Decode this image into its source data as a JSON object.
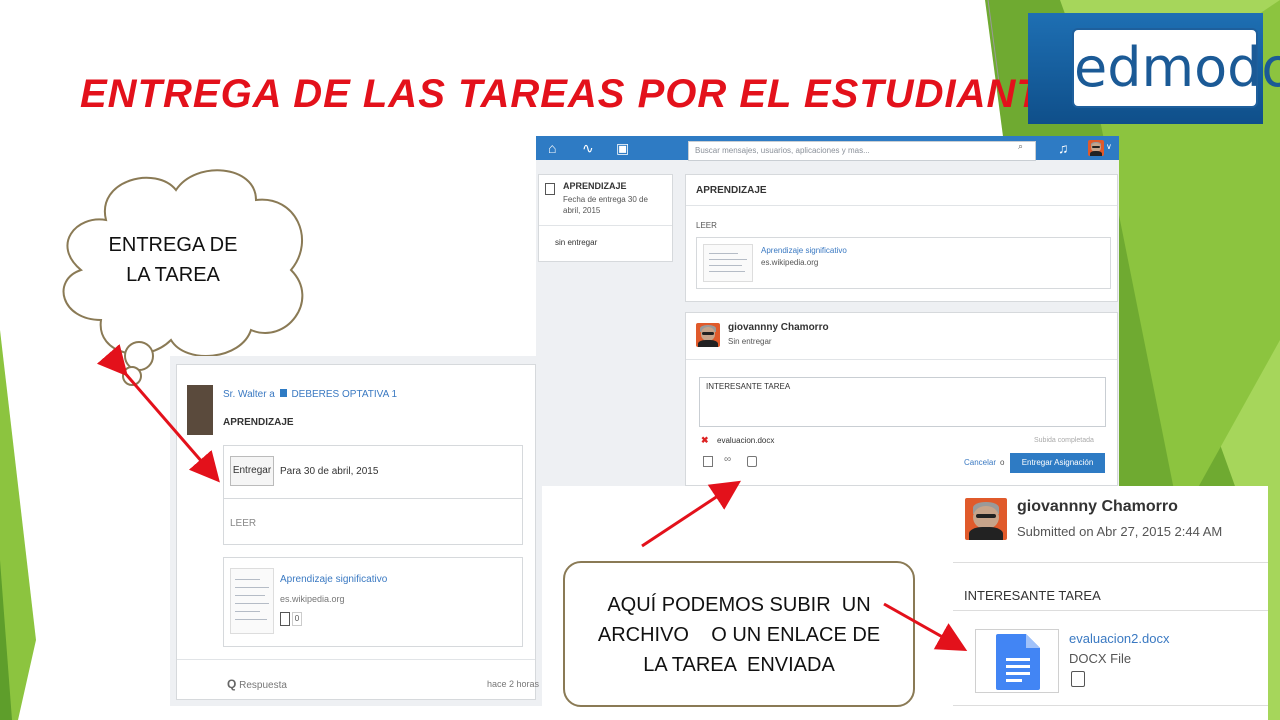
{
  "slide": {
    "title": "ENTREGA DE LAS TAREAS POR EL ESTUDIANTE",
    "logo_text": "edmodo",
    "cloud_line1": "ENTREGA DE",
    "cloud_line2": "LA TAREA",
    "callout_line1": "AQUÍ PODEMOS SUBIR  UN",
    "callout_line2": "ARCHIVO    O UN ENLACE DE",
    "callout_line3": "LA TAREA  ENVIADA"
  },
  "student_view": {
    "post_author": "Sr. Walter a",
    "group_name": "DEBERES OPTATIVA 1",
    "assignment_title": "APRENDIZAJE",
    "submit_button": "Entregar",
    "due_text": "Para 30 de abril, 2015",
    "read_label": "LEER",
    "link_title": "Aprendizaje significativo",
    "link_domain": "es.wikipedia.org",
    "link_count": "0",
    "reply_label": "Respuesta",
    "time_ago": "hace 2 horas"
  },
  "edmodo_app": {
    "search_placeholder": "Buscar mensajes, usuarios, aplicaciones y mas...",
    "sidebar_title": "APRENDIZAJE",
    "sidebar_due_line1": "Fecha de entrega 30 de",
    "sidebar_due_line2": "abril, 2015",
    "sidebar_status": "sin entregar",
    "assignment_heading": "APRENDIZAJE",
    "read_label": "LEER",
    "link_title": "Aprendizaje significativo",
    "link_domain": "es.wikipedia.org",
    "student_name": "giovannny Chamorro",
    "student_status": "Sin entregar",
    "comment_text": "INTERESANTE TAREA",
    "file_name": "evaluacion.docx",
    "upload_status": "Subida completada",
    "cancel_label": "Cancelar",
    "or_label": "o",
    "submit_assignment_button": "Entregar Asignación"
  },
  "teacher_view": {
    "student_name": "giovannny Chamorro",
    "submitted_text": "Submitted on Abr 27, 2015 2:44 AM",
    "comment_text": "INTERESANTE TAREA",
    "file_name": "evaluacion2.docx",
    "file_type": "DOCX File"
  },
  "colors": {
    "title_red": "#e3111b",
    "edmodo_blue": "#2e7bc4",
    "green_light": "#9bd24a",
    "green_dark": "#5e9e2b",
    "arrow_red": "#e3111b",
    "cloud_border": "#8a7a55"
  }
}
